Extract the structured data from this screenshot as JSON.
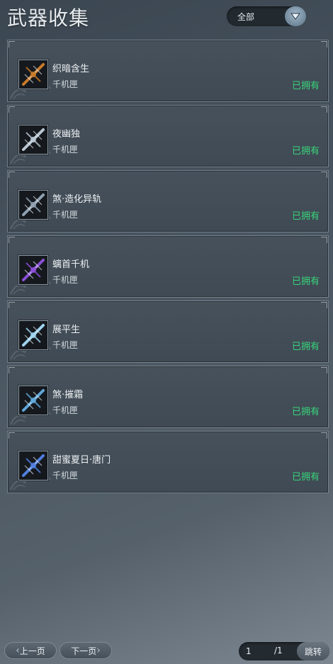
{
  "header": {
    "title": "武器收集"
  },
  "filter": {
    "selected": "全部"
  },
  "items": [
    {
      "name": "织暗含生",
      "type": "千机匣",
      "status": "已拥有",
      "icon": "crossbow-dragon-icon",
      "accent": "#c87a2a"
    },
    {
      "name": "夜幽独",
      "type": "千机匣",
      "status": "已拥有",
      "icon": "crossbow-silver-icon",
      "accent": "#b9c6d2"
    },
    {
      "name": "煞·造化异轨",
      "type": "千机匣",
      "status": "已拥有",
      "icon": "crossbow-dark-icon",
      "accent": "#8fa0b0"
    },
    {
      "name": "螭首千机",
      "type": "千机匣",
      "status": "已拥有",
      "icon": "crossbow-purple-icon",
      "accent": "#8a4fd6"
    },
    {
      "name": "展平生",
      "type": "千机匣",
      "status": "已拥有",
      "icon": "crossbow-ice-icon",
      "accent": "#9fd4f0"
    },
    {
      "name": "煞·摧霜",
      "type": "千机匣",
      "status": "已拥有",
      "icon": "crossbow-frost-icon",
      "accent": "#5fa6d8"
    },
    {
      "name": "甜蜜夏日·唐门",
      "type": "千机匣",
      "status": "已拥有",
      "icon": "crossbow-blue-icon",
      "accent": "#4f7ee0"
    }
  ],
  "pagination": {
    "prev_label": "上一页",
    "next_label": "下一页",
    "current_page": "1",
    "total_pages": "/1",
    "jump_label": "跳转"
  },
  "colors": {
    "owned": "#38d47a",
    "card_border": "#76828d"
  }
}
